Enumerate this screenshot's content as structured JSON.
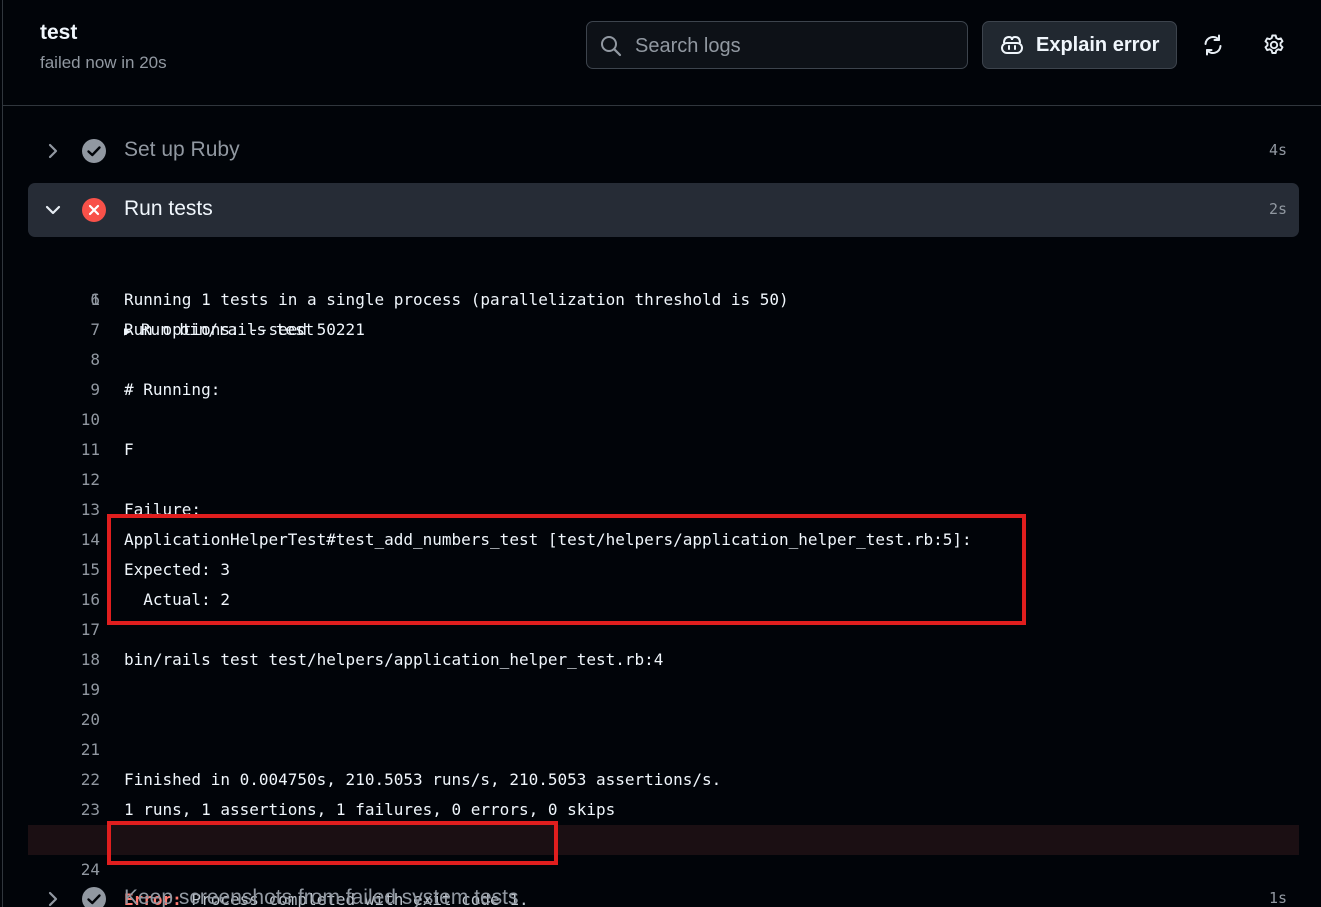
{
  "header": {
    "job_title": "test",
    "job_status": "failed now in 20s",
    "search_placeholder": "Search logs",
    "explain_button_label": "Explain error"
  },
  "steps": [
    {
      "name": "Set up Ruby",
      "duration": "4s",
      "status": "success",
      "expanded": false
    },
    {
      "name": "Run tests",
      "duration": "2s",
      "status": "failure",
      "expanded": true
    },
    {
      "name": "Keep screenshots from failed system tests",
      "duration": "1s",
      "status": "success",
      "expanded": false
    }
  ],
  "log": [
    {
      "n": "1",
      "text": "Run bin/rails test",
      "group": true
    },
    {
      "n": "6",
      "text": "Running 1 tests in a single process (parallelization threshold is 50)"
    },
    {
      "n": "7",
      "text": "Run options: --seed 50221"
    },
    {
      "n": "8",
      "text": ""
    },
    {
      "n": "9",
      "text": "# Running:"
    },
    {
      "n": "10",
      "text": ""
    },
    {
      "n": "11",
      "text": "F"
    },
    {
      "n": "12",
      "text": ""
    },
    {
      "n": "13",
      "text": "Failure:"
    },
    {
      "n": "14",
      "text": "ApplicationHelperTest#test_add_numbers_test [test/helpers/application_helper_test.rb:5]:"
    },
    {
      "n": "15",
      "text": "Expected: 3"
    },
    {
      "n": "16",
      "text": "  Actual: 2"
    },
    {
      "n": "17",
      "text": ""
    },
    {
      "n": "18",
      "text": "bin/rails test test/helpers/application_helper_test.rb:4"
    },
    {
      "n": "19",
      "text": ""
    },
    {
      "n": "20",
      "text": ""
    },
    {
      "n": "21",
      "text": ""
    },
    {
      "n": "22",
      "text": "Finished in 0.004750s, 210.5053 runs/s, 210.5053 assertions/s."
    },
    {
      "n": "23",
      "text": "1 runs, 1 assertions, 1 failures, 0 errors, 0 skips"
    },
    {
      "n": "24",
      "text": "",
      "error_label": "Error:",
      "error_text": " Process completed with exit code 1."
    }
  ],
  "colors": {
    "background": "#010409",
    "expanded_step_bg": "#262c36",
    "failure": "#f85149",
    "success_icon": "#9198a1",
    "annotation_box": "#e01e1e"
  }
}
